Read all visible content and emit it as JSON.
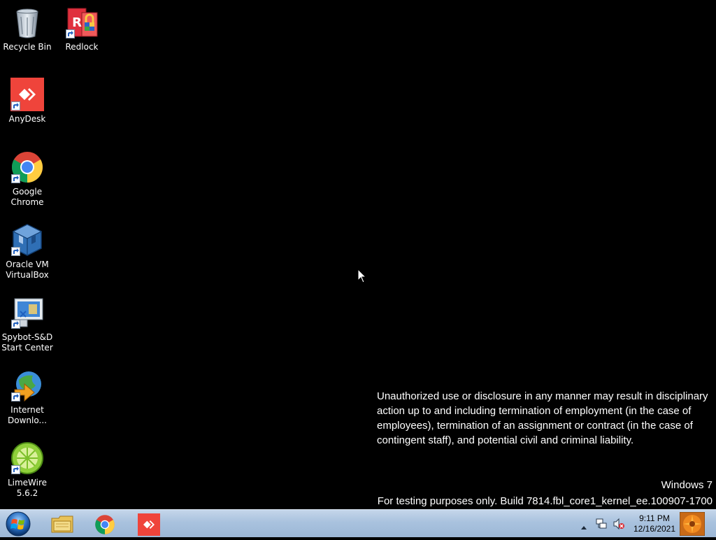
{
  "desktop": {
    "icons": [
      {
        "label": "Recycle Bin"
      },
      {
        "label": "Redlock"
      },
      {
        "label": "AnyDesk"
      },
      {
        "label": "Google Chrome"
      },
      {
        "label": "Oracle VM VirtualBox"
      },
      {
        "label": "Spybot-S&D Start Center"
      },
      {
        "label": "Internet Downlo..."
      },
      {
        "label": "LimeWire 5.6.2"
      }
    ],
    "notice": "Unauthorized use or disclosure in any manner may result in disciplinary action up to and including termination of employment (in the case of employees), termination of an assignment or contract (in the case of contingent staff), and potential civil and criminal liability.",
    "watermark": {
      "os": "Windows 7",
      "build": "For testing purposes only. Build 7814.fbl_core1_kernel_ee.100907-1700"
    }
  },
  "taskbar": {
    "pinned": [
      "file-explorer-icon",
      "chrome-icon",
      "anydesk-icon"
    ],
    "clock": {
      "time": "9:11 PM",
      "date": "12/16/2021"
    }
  },
  "colors": {
    "desktop_bg": "#000000",
    "anydesk_red": "#ef443b",
    "taskbar": "#a9c2de"
  }
}
